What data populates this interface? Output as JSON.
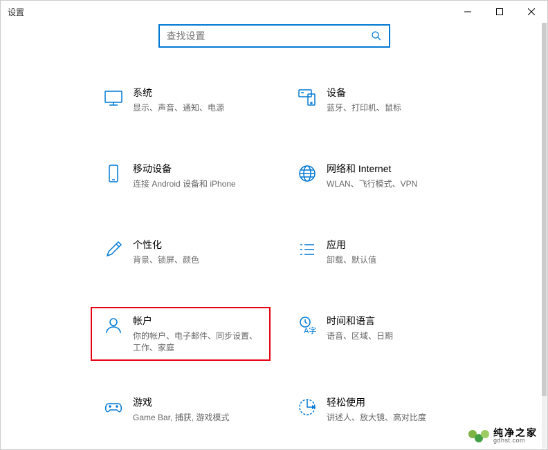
{
  "window": {
    "title": "设置"
  },
  "search": {
    "placeholder": "查找设置"
  },
  "tiles": {
    "system": {
      "title": "系统",
      "desc": "显示、声音、通知、电源"
    },
    "devices": {
      "title": "设备",
      "desc": "蓝牙、打印机、鼠标"
    },
    "phone": {
      "title": "移动设备",
      "desc": "连接 Android 设备和 iPhone"
    },
    "network": {
      "title": "网络和 Internet",
      "desc": "WLAN、飞行模式、VPN"
    },
    "personal": {
      "title": "个性化",
      "desc": "背景、锁屏、颜色"
    },
    "apps": {
      "title": "应用",
      "desc": "卸载、默认值"
    },
    "accounts": {
      "title": "帐户",
      "desc": "你的帐户、电子邮件、同步设置、工作、家庭"
    },
    "time": {
      "title": "时间和语言",
      "desc": "语音、区域、日期"
    },
    "gaming": {
      "title": "游戏",
      "desc": "Game Bar, 捕获, 游戏模式"
    },
    "ease": {
      "title": "轻松使用",
      "desc": "讲述人、放大镜、高对比度"
    }
  },
  "colors": {
    "accent": "#0078d4"
  },
  "watermark": {
    "main": "纯净之家",
    "sub": "gdhst.com"
  }
}
